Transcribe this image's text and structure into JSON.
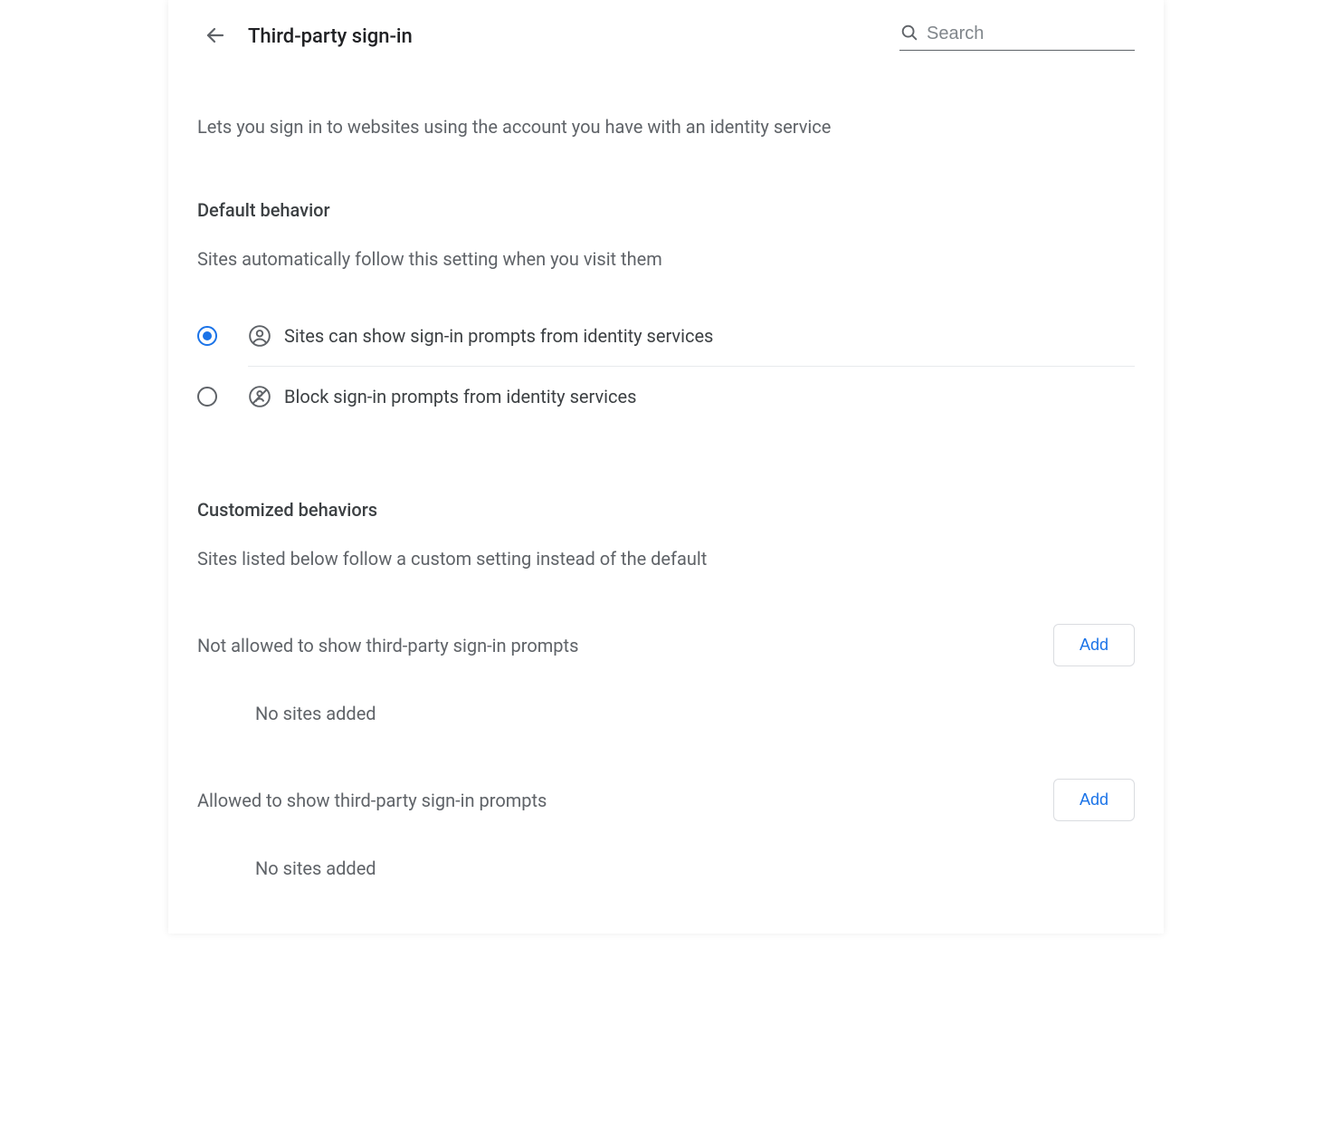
{
  "header": {
    "title": "Third-party sign-in",
    "search_placeholder": "Search"
  },
  "description": "Lets you sign in to websites using the account you have with an identity service",
  "default_behavior": {
    "heading": "Default behavior",
    "subtext": "Sites automatically follow this setting when you visit them",
    "options": [
      {
        "label": "Sites can show sign-in prompts from identity services",
        "selected": true
      },
      {
        "label": "Block sign-in prompts from identity services",
        "selected": false
      }
    ]
  },
  "customized": {
    "heading": "Customized behaviors",
    "subtext": "Sites listed below follow a custom setting instead of the default",
    "sections": [
      {
        "label": "Not allowed to show third-party sign-in prompts",
        "add_label": "Add",
        "empty_text": "No sites added"
      },
      {
        "label": "Allowed to show third-party sign-in prompts",
        "add_label": "Add",
        "empty_text": "No sites added"
      }
    ]
  }
}
